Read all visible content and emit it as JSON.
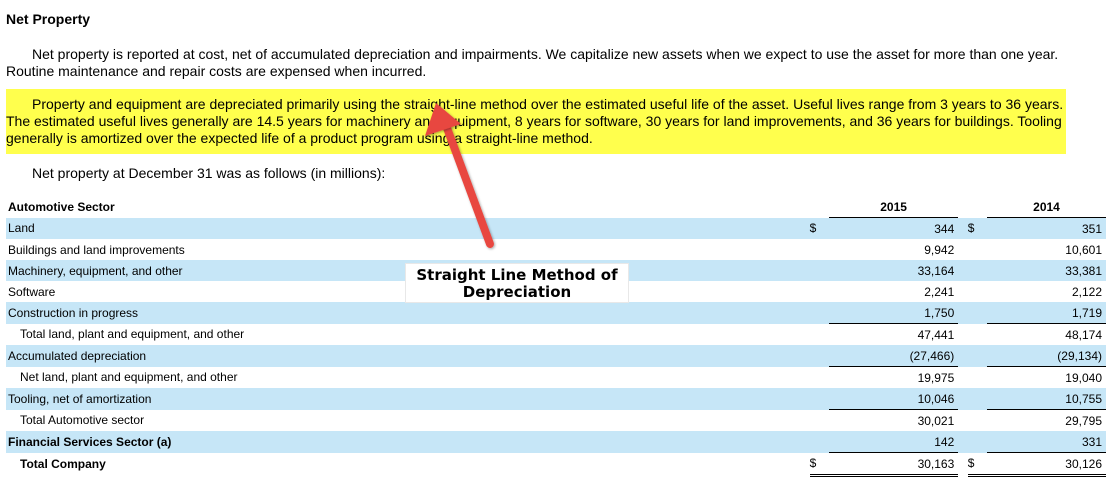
{
  "section_title": "Net Property",
  "paragraphs": {
    "p1": "Net property is reported at cost, net of accumulated depreciation and impairments.  We capitalize new assets when we expect to use the asset for more than one year.  Routine maintenance and repair costs are expensed when incurred.",
    "p2": "Property and equipment are depreciated primarily using the straight-line method over the estimated useful life of the asset.  Useful lives range from 3 years to 36 years.  The estimated useful lives generally are 14.5 years for machinery and equipment, 8 years for software, 30 years for land improvements, and 36 years for buildings.  Tooling generally is amortized over the expected life of a product program using a straight-line method.",
    "p3": "Net property at December 31 was as follows (in millions):"
  },
  "highlight_color": "#ffff4d",
  "table": {
    "header": {
      "label": "Automotive Sector",
      "year1": "2015",
      "year2": "2014"
    },
    "rows": [
      {
        "label": "Land",
        "cur1": "$",
        "v2015": "344",
        "cur2": "$",
        "v2014": "351"
      },
      {
        "label": "Buildings and land improvements",
        "v2015": "9,942",
        "v2014": "10,601"
      },
      {
        "label": "Machinery, equipment, and other",
        "v2015": "33,164",
        "v2014": "33,381"
      },
      {
        "label": "Software",
        "v2015": "2,241",
        "v2014": "2,122"
      },
      {
        "label": "Construction in progress",
        "v2015": "1,750",
        "v2014": "1,719"
      },
      {
        "label": "Total land, plant and equipment, and other",
        "v2015": "47,441",
        "v2014": "48,174"
      },
      {
        "label": "Accumulated depreciation",
        "v2015": "(27,466)",
        "v2014": "(29,134)"
      },
      {
        "label": "Net land, plant and equipment, and other",
        "v2015": "19,975",
        "v2014": "19,040"
      },
      {
        "label": "Tooling, net of amortization",
        "v2015": "10,046",
        "v2014": "10,755"
      },
      {
        "label": "Total Automotive sector",
        "v2015": "30,021",
        "v2014": "29,795"
      },
      {
        "label": "Financial Services Sector (a)",
        "v2015": "142",
        "v2014": "331"
      },
      {
        "label": "Total Company",
        "cur1": "$",
        "v2015": "30,163",
        "cur2": "$",
        "v2014": "30,126"
      }
    ]
  },
  "callout": {
    "line1": "Straight Line Method of",
    "line2": "Depreciation"
  },
  "arrow_color": "#e8473f",
  "row_shade_color": "#c6e6f7"
}
